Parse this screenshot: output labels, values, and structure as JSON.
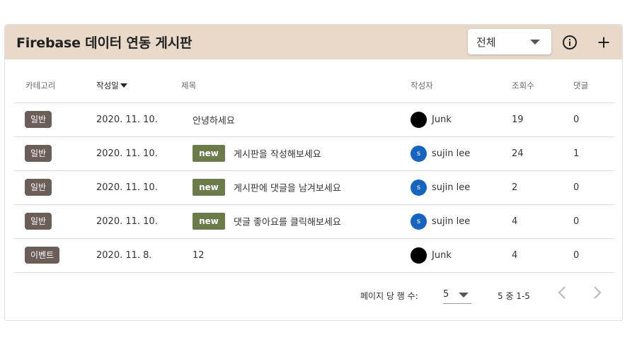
{
  "board": {
    "title": "Firebase 데이터 연동 게시판",
    "filter": {
      "selected": "전체"
    },
    "icons": {
      "info": "info-icon",
      "add": "plus-icon"
    }
  },
  "table": {
    "headers": {
      "category": "카테고리",
      "date": "작성일",
      "title": "제목",
      "author": "작성자",
      "views": "조회수",
      "comments": "댓글"
    },
    "rows": [
      {
        "category": "일반",
        "date": "2020. 11. 10.",
        "is_new": false,
        "title": "안녕하세요",
        "author": "Junk",
        "avatar": "",
        "views": "19",
        "comments": "0"
      },
      {
        "category": "일반",
        "date": "2020. 11. 10.",
        "is_new": true,
        "title": "게시판을 작성해보세요",
        "author": "sujin lee",
        "avatar": "s",
        "views": "24",
        "comments": "1"
      },
      {
        "category": "일반",
        "date": "2020. 11. 10.",
        "is_new": true,
        "title": "게시판에 댓글을 남겨보세요",
        "author": "sujin lee",
        "avatar": "s",
        "views": "2",
        "comments": "0"
      },
      {
        "category": "일반",
        "date": "2020. 11. 10.",
        "is_new": true,
        "title": "댓글 좋아요를 클릭해보세요",
        "author": "sujin lee",
        "avatar": "s",
        "views": "4",
        "comments": "0"
      },
      {
        "category": "이벤트",
        "date": "2020. 11. 8.",
        "is_new": false,
        "title": "12",
        "author": "Junk",
        "avatar": "",
        "views": "4",
        "comments": "0"
      }
    ],
    "new_label": "new"
  },
  "pagination": {
    "rows_per_page_label": "페이지 당 행 수:",
    "rows_per_page": "5",
    "range": "5 중 1-5"
  },
  "colors": {
    "toolbar_bg": "#e8d9c9",
    "chip_bg": "#6b5e59",
    "new_badge_bg": "#6b7b4a",
    "avatar_blue": "#1565c0"
  }
}
